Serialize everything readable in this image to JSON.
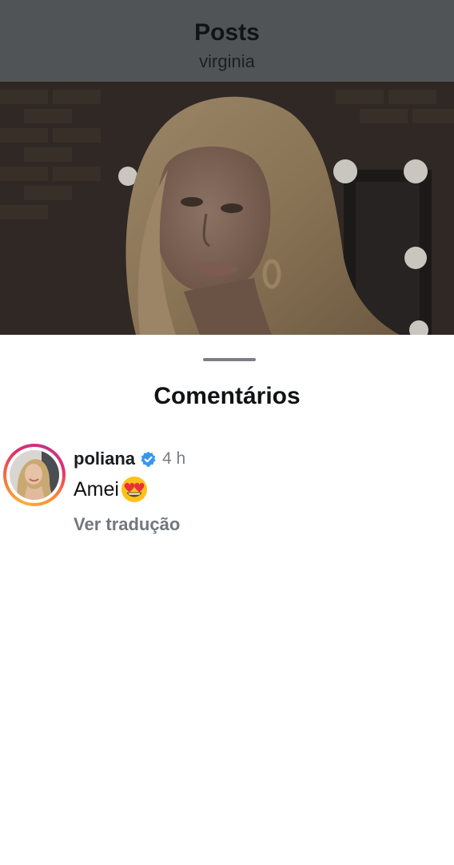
{
  "header": {
    "title": "Posts",
    "subtitle": "virginia"
  },
  "post": {
    "image_icon": "portrait-photo"
  },
  "sheet": {
    "title": "Comentários"
  },
  "comments": [
    {
      "username": "poliana",
      "verified_icon": "verified-badge-icon",
      "timestamp": "4 h",
      "text": "Amei",
      "emoji_icon": "heart-eyes-emoji",
      "translate_label": "Ver tradução"
    }
  ],
  "colors": {
    "verified": "#3897f0",
    "dim_overlay": "#515456",
    "secondary_text": "#73777d"
  }
}
